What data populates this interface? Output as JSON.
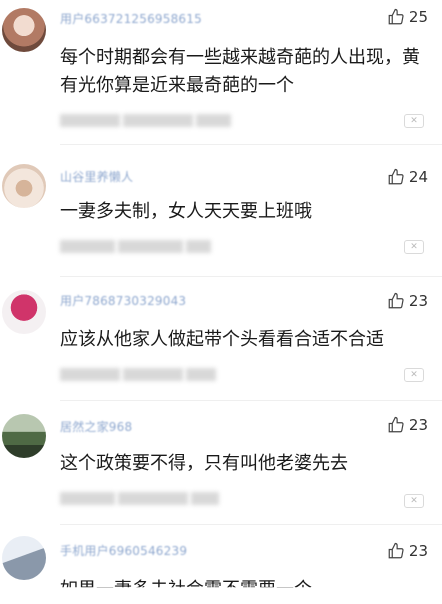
{
  "comments": [
    {
      "username": "用户663721256958615",
      "likes": "25",
      "text": "每个时期都会有一些越来越奇葩的人出现，黄有光你算是近来最奇葩的一个",
      "avatar_color": "#d9b8a8"
    },
    {
      "username": "山谷里养懒人",
      "likes": "24",
      "text": "一妻多夫制，女人天天要上班哦",
      "avatar_color": "#e8d2c2"
    },
    {
      "username": "用户7868730329043",
      "likes": "23",
      "text": "应该从他家人做起带个头看看合适不合适",
      "avatar_color": "#c93b6e"
    },
    {
      "username": "居然之家968",
      "likes": "23",
      "text": "这个政策要不得，只有叫他老婆先去",
      "avatar_color": "#6f8a68"
    },
    {
      "username": "手机用户6960546239",
      "likes": "23",
      "text": "如果一妻多夫社会需不需要一个……",
      "avatar_color": "#9aa7b6"
    }
  ],
  "icons": {
    "like": "thumbs-up-icon",
    "close": "close-icon"
  },
  "close_glyph": "✕"
}
